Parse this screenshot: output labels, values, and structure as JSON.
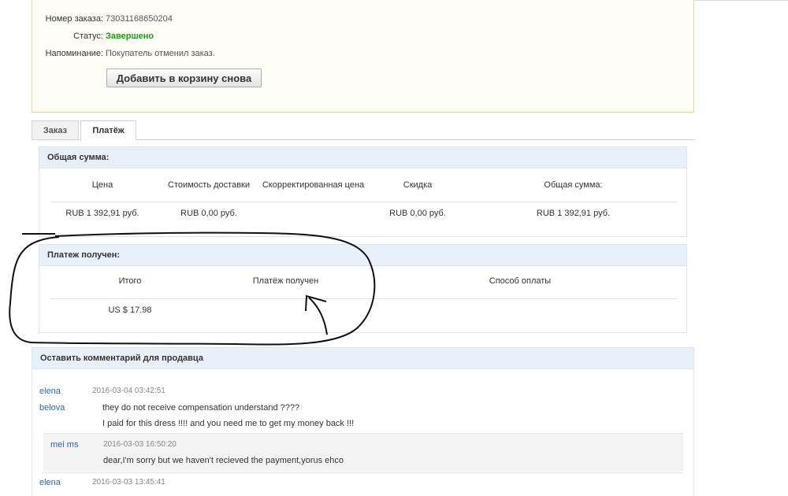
{
  "order": {
    "number_label": "Номер заказа:",
    "number": "73031168650204",
    "status_label": "Статус:",
    "status": "Завершено",
    "reminder_label": "Напоминание:",
    "reminder": "Покупатель отменил заказ.",
    "readd_button": "Добавить в корзину снова"
  },
  "tabs": [
    "Заказ",
    "Платёж"
  ],
  "total": {
    "title": "Общая сумма:",
    "headers": [
      "Цена",
      "Стоимость доставки",
      "Скорректированная цена",
      "Скидка",
      "Общая сумма:"
    ],
    "values": [
      "RUB 1 392,91 руб.",
      "RUB 0,00 руб.",
      "",
      "RUB 0,00 руб.",
      "RUB 1 392,91 руб."
    ]
  },
  "payment": {
    "title": "Платеж получен:",
    "headers": [
      "Итого",
      "Платёж получен",
      "Способ оплаты"
    ],
    "values": [
      "US $ 17.98",
      "",
      ""
    ]
  },
  "comments": {
    "title": "Оставить комментарий для продавца",
    "items": [
      {
        "user": "elena",
        "date": "2016-03-04 03:42:51"
      },
      {
        "user": "belova",
        "line1": "they do not receive compensation understand ????",
        "line2": "I paid for this dress !!!! and you need me to get my money back !!!"
      },
      {
        "user": "mei ms",
        "date": "2016-03-03 16:50:20",
        "line1": "dear,I'm sorry but we haven't recieved the payment,yorus ehco"
      },
      {
        "user": "elena",
        "date": "2016-03-03 13:45:41"
      }
    ]
  },
  "annotation": {
    "color": "#111111"
  }
}
